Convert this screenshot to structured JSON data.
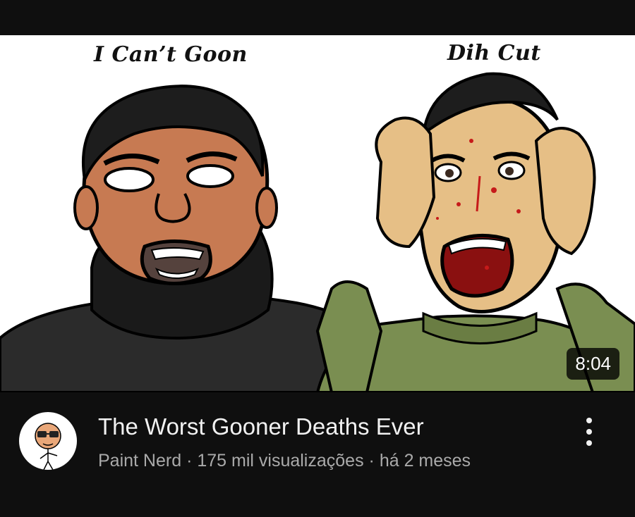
{
  "video": {
    "thumbnail": {
      "caption_left": "I Can’t Goon",
      "caption_right": "Dih Cut",
      "duration": "8:04"
    },
    "title": "The Worst Gooner Deaths Ever",
    "channel": "Paint Nerd",
    "views": "175 mil visualizações",
    "age": "há 2 meses",
    "separator": "·"
  },
  "icons": {
    "more": "more-vert-icon",
    "avatar": "channel-avatar"
  },
  "colors": {
    "background": "#0f0f0f",
    "title": "#f1f1f1",
    "subtext": "#aaaaaa"
  }
}
